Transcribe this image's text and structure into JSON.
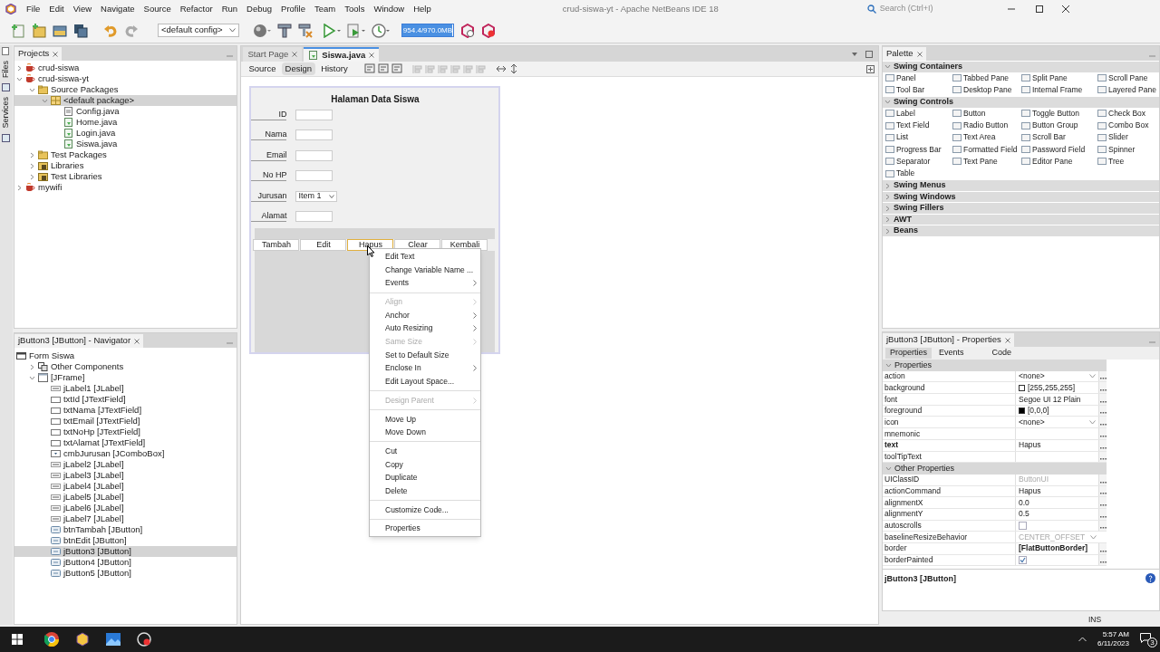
{
  "window": {
    "title": "crud-siswa-yt - Apache NetBeans IDE 18"
  },
  "menu": [
    "File",
    "Edit",
    "View",
    "Navigate",
    "Source",
    "Refactor",
    "Run",
    "Debug",
    "Profile",
    "Team",
    "Tools",
    "Window",
    "Help"
  ],
  "search": {
    "placeholder": "Search (Ctrl+I)"
  },
  "toolbar": {
    "config": "<default config>",
    "memory": {
      "reading": "954.4/970.0MB",
      "level": 0.98
    }
  },
  "side_tabs": [
    "Files",
    "Services"
  ],
  "projects": {
    "title": "Projects",
    "tree": [
      {
        "label": "crud-siswa",
        "kind": "project",
        "expanded": false,
        "selected": false
      },
      {
        "label": "crud-siswa-yt",
        "kind": "project",
        "expanded": true,
        "selected": false,
        "children": [
          {
            "label": "Source Packages",
            "kind": "folder",
            "expanded": true,
            "selected": false,
            "children": [
              {
                "label": "<default package>",
                "kind": "package",
                "expanded": true,
                "selected": true,
                "children": [
                  {
                    "label": "Config.java",
                    "kind": "java",
                    "selected": false
                  },
                  {
                    "label": "Home.java",
                    "kind": "form",
                    "selected": false
                  },
                  {
                    "label": "Login.java",
                    "kind": "form",
                    "selected": false
                  },
                  {
                    "label": "Siswa.java",
                    "kind": "form",
                    "selected": false
                  }
                ]
              }
            ]
          },
          {
            "label": "Test Packages",
            "kind": "folder",
            "expanded": false,
            "selected": false
          },
          {
            "label": "Libraries",
            "kind": "library",
            "expanded": false,
            "selected": false
          },
          {
            "label": "Test Libraries",
            "kind": "library",
            "expanded": false,
            "selected": false
          }
        ]
      },
      {
        "label": "mywifi",
        "kind": "project",
        "expanded": false,
        "selected": false
      }
    ]
  },
  "navigator": {
    "title": "jButton3 [JButton] - Navigator",
    "tree": [
      {
        "label": "Form Siswa",
        "kind": "form-root",
        "selected": false,
        "children": [
          {
            "label": "Other Components",
            "kind": "components",
            "expanded": false,
            "selected": false
          },
          {
            "label": "[JFrame]",
            "kind": "frame",
            "expanded": true,
            "selected": false,
            "children": [
              {
                "label": "jLabel1 [JLabel]",
                "kind": "label",
                "selected": false
              },
              {
                "label": "txtId [JTextField]",
                "kind": "textfield",
                "selected": false
              },
              {
                "label": "txtNama [JTextField]",
                "kind": "textfield",
                "selected": false
              },
              {
                "label": "txtEmail [JTextField]",
                "kind": "textfield",
                "selected": false
              },
              {
                "label": "txtNoHp [JTextField]",
                "kind": "textfield",
                "selected": false
              },
              {
                "label": "txtAlamat [JTextField]",
                "kind": "textfield",
                "selected": false
              },
              {
                "label": "cmbJurusan [JComboBox]",
                "kind": "combobox",
                "selected": false
              },
              {
                "label": "jLabel2 [JLabel]",
                "kind": "label",
                "selected": false
              },
              {
                "label": "jLabel3 [JLabel]",
                "kind": "label",
                "selected": false
              },
              {
                "label": "jLabel4 [JLabel]",
                "kind": "label",
                "selected": false
              },
              {
                "label": "jLabel5 [JLabel]",
                "kind": "label",
                "selected": false
              },
              {
                "label": "jLabel6 [JLabel]",
                "kind": "label",
                "selected": false
              },
              {
                "label": "jLabel7 [JLabel]",
                "kind": "label",
                "selected": false
              },
              {
                "label": "btnTambah [JButton]",
                "kind": "button",
                "selected": false
              },
              {
                "label": "btnEdit [JButton]",
                "kind": "button",
                "selected": false
              },
              {
                "label": "jButton3 [JButton]",
                "kind": "button",
                "selected": true
              },
              {
                "label": "jButton4 [JButton]",
                "kind": "button",
                "selected": false
              },
              {
                "label": "jButton5 [JButton]",
                "kind": "button",
                "selected": false
              }
            ]
          }
        ]
      }
    ]
  },
  "editor": {
    "tabs": [
      {
        "label": "Start Page",
        "selected": false
      },
      {
        "label": "Siswa.java",
        "selected": true
      }
    ],
    "views": [
      {
        "label": "Source",
        "selected": false
      },
      {
        "label": "Design",
        "selected": true
      },
      {
        "label": "History",
        "selected": false
      }
    ],
    "form": {
      "title": "Halaman Data Siswa",
      "fields": [
        {
          "label": "ID",
          "kind": "text"
        },
        {
          "label": "Nama",
          "kind": "text"
        },
        {
          "label": "Email",
          "kind": "text"
        },
        {
          "label": "No HP",
          "kind": "text"
        },
        {
          "label": "Jurusan",
          "kind": "combo",
          "value": "Item 1"
        },
        {
          "label": "Alamat",
          "kind": "text"
        }
      ],
      "buttons": [
        {
          "label": "Tambah",
          "selected": false
        },
        {
          "label": "Edit",
          "selected": false
        },
        {
          "label": "Hapus",
          "selected": true
        },
        {
          "label": "Clear",
          "selected": false
        },
        {
          "label": "Kembali",
          "selected": false
        }
      ]
    }
  },
  "context_menu": [
    [
      {
        "label": "Edit Text",
        "disabled": false,
        "submenu": false
      },
      {
        "label": "Change Variable Name ...",
        "disabled": false,
        "submenu": false
      },
      {
        "label": "Events",
        "disabled": false,
        "submenu": true
      }
    ],
    [
      {
        "label": "Align",
        "disabled": true,
        "submenu": true
      },
      {
        "label": "Anchor",
        "disabled": false,
        "submenu": true
      },
      {
        "label": "Auto Resizing",
        "disabled": false,
        "submenu": true
      },
      {
        "label": "Same Size",
        "disabled": true,
        "submenu": true
      },
      {
        "label": "Set to Default Size",
        "disabled": false,
        "submenu": false
      },
      {
        "label": "Enclose In",
        "disabled": false,
        "submenu": true
      },
      {
        "label": "Edit Layout Space...",
        "disabled": false,
        "submenu": false
      }
    ],
    [
      {
        "label": "Design Parent",
        "disabled": true,
        "submenu": true
      }
    ],
    [
      {
        "label": "Move Up",
        "disabled": false,
        "submenu": false
      },
      {
        "label": "Move Down",
        "disabled": false,
        "submenu": false
      }
    ],
    [
      {
        "label": "Cut",
        "disabled": false,
        "submenu": false
      },
      {
        "label": "Copy",
        "disabled": false,
        "submenu": false
      },
      {
        "label": "Duplicate",
        "disabled": false,
        "submenu": false
      },
      {
        "label": "Delete",
        "disabled": false,
        "submenu": false
      }
    ],
    [
      {
        "label": "Customize Code...",
        "disabled": false,
        "submenu": false
      }
    ],
    [
      {
        "label": "Properties",
        "disabled": false,
        "submenu": false
      }
    ]
  ],
  "palette": {
    "title": "Palette",
    "categories": [
      {
        "label": "Swing Containers",
        "expanded": true,
        "items": [
          "Panel",
          "Tabbed Pane",
          "Split Pane",
          "Scroll Pane",
          "Tool Bar",
          "Desktop Pane",
          "Internal Frame",
          "Layered Pane"
        ]
      },
      {
        "label": "Swing Controls",
        "expanded": true,
        "items": [
          "Label",
          "Button",
          "Toggle Button",
          "Check Box",
          "Text Field",
          "Radio Button",
          "Button Group",
          "Combo Box",
          "List",
          "Text Area",
          "Scroll Bar",
          "Slider",
          "Progress Bar",
          "Formatted Field",
          "Password Field",
          "Spinner",
          "Separator",
          "Text Pane",
          "Editor Pane",
          "Tree",
          "Table"
        ]
      },
      {
        "label": "Swing Menus",
        "expanded": false
      },
      {
        "label": "Swing Windows",
        "expanded": false
      },
      {
        "label": "Swing Fillers",
        "expanded": false
      },
      {
        "label": "AWT",
        "expanded": false
      },
      {
        "label": "Beans",
        "expanded": false
      }
    ]
  },
  "properties": {
    "title": "jButton3 [JButton] - Properties",
    "tabs": [
      {
        "label": "Properties",
        "selected": true
      },
      {
        "label": "Events",
        "selected": false
      },
      {
        "label": "Code",
        "selected": false
      }
    ],
    "sections": [
      {
        "label": "Properties",
        "expanded": true,
        "rows": [
          {
            "name": "action",
            "bold": false,
            "kind": "dropdown",
            "value": "<none>",
            "value_bold": false,
            "value_disabled": false
          },
          {
            "name": "background",
            "bold": false,
            "kind": "color",
            "color": "#ffffff",
            "value": "[255,255,255]",
            "value_bold": false,
            "value_disabled": false
          },
          {
            "name": "font",
            "bold": false,
            "kind": "text",
            "value": "Segoe UI 12 Plain",
            "value_bold": false,
            "value_disabled": false
          },
          {
            "name": "foreground",
            "bold": false,
            "kind": "color",
            "color": "#000000",
            "value": "[0,0,0]",
            "value_bold": false,
            "value_disabled": false
          },
          {
            "name": "icon",
            "bold": false,
            "kind": "dropdown",
            "value": "<none>",
            "value_bold": false,
            "value_disabled": false
          },
          {
            "name": "mnemonic",
            "bold": false,
            "kind": "empty"
          },
          {
            "name": "text",
            "bold": true,
            "kind": "text",
            "value": "Hapus",
            "value_bold": false,
            "value_disabled": false
          },
          {
            "name": "toolTipText",
            "bold": false,
            "kind": "empty"
          }
        ]
      },
      {
        "label": "Other Properties",
        "expanded": true,
        "rows": [
          {
            "name": "UIClassID",
            "bold": false,
            "kind": "text",
            "value": "ButtonUI",
            "value_bold": false,
            "value_disabled": true
          },
          {
            "name": "actionCommand",
            "bold": false,
            "kind": "text",
            "value": "Hapus",
            "value_bold": false,
            "value_disabled": false
          },
          {
            "name": "alignmentX",
            "bold": false,
            "kind": "text",
            "value": "0.0",
            "value_bold": false,
            "value_disabled": false
          },
          {
            "name": "alignmentY",
            "bold": false,
            "kind": "text",
            "value": "0.5",
            "value_bold": false,
            "value_disabled": false
          },
          {
            "name": "autoscrolls",
            "bold": false,
            "kind": "checkbox",
            "checked": false
          },
          {
            "name": "baselineResizeBehavior",
            "bold": false,
            "kind": "dropdown",
            "value": "CENTER_OFFSET",
            "value_bold": false,
            "value_disabled": true
          },
          {
            "name": "border",
            "bold": false,
            "kind": "text",
            "value": "[FlatButtonBorder]",
            "value_bold": true,
            "value_disabled": false
          },
          {
            "name": "borderPainted",
            "bold": false,
            "kind": "checkbox",
            "checked": true
          }
        ]
      }
    ],
    "footer": "jButton3 [JButton]"
  },
  "status_bar": {
    "mode": "INS"
  },
  "taskbar": {
    "time": "5:57 AM",
    "date": "6/11/2023",
    "notifications": "3"
  }
}
